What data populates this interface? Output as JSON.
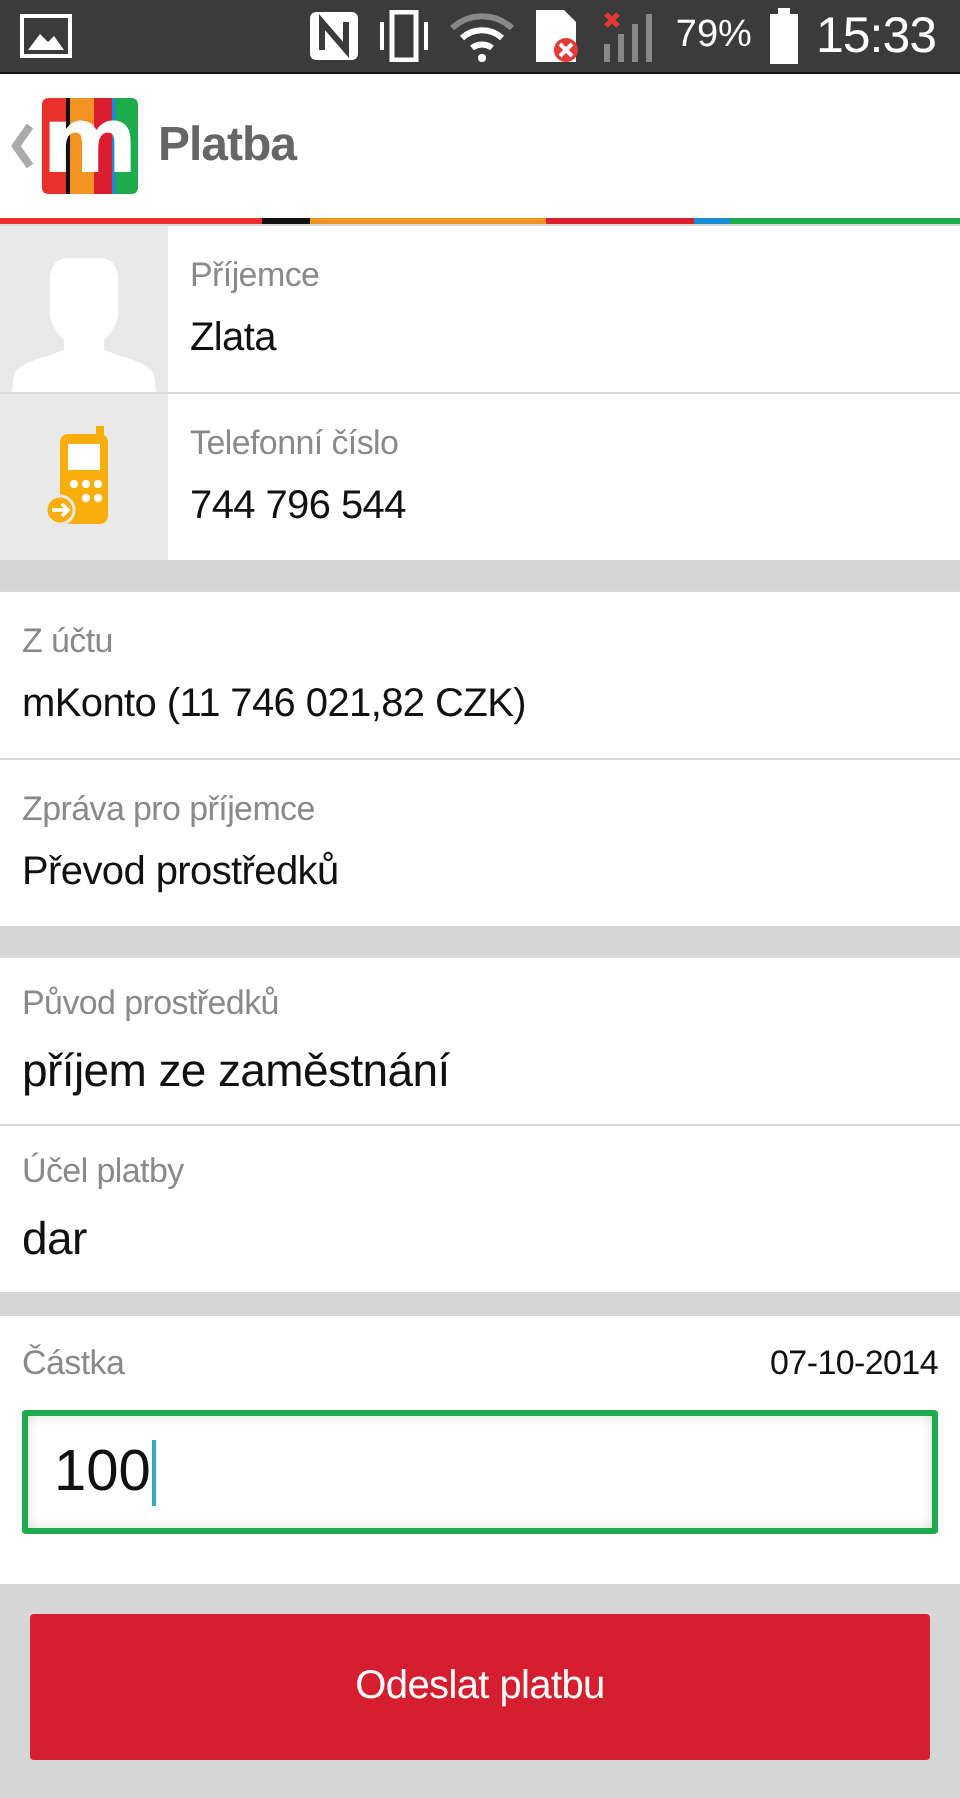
{
  "status_bar": {
    "battery": "79%",
    "time": "15:33"
  },
  "header": {
    "logo": "m",
    "title": "Platba"
  },
  "sections": [
    {
      "rows": [
        {
          "kind": "person",
          "label": "Příjemce",
          "value": "Zlata"
        },
        {
          "kind": "phone",
          "label": "Telefonní číslo",
          "value": "744 796 544"
        }
      ]
    },
    {
      "rows": [
        {
          "kind": "plain",
          "label": "Z účtu",
          "value": "mKonto  (11 746 021,82 CZK)"
        },
        {
          "kind": "plain",
          "label": "Zpráva pro příjemce",
          "value": "Převod prostředků"
        }
      ]
    },
    {
      "rows": [
        {
          "kind": "plain",
          "label": "Původ prostředků",
          "value": "příjem ze zaměstnání"
        },
        {
          "kind": "plain",
          "label": "Účel platby",
          "value": "dar"
        }
      ]
    }
  ],
  "amount": {
    "label": "Částka",
    "date": "07-10-2014",
    "value": "100"
  },
  "submit_button": "Odeslat platbu"
}
